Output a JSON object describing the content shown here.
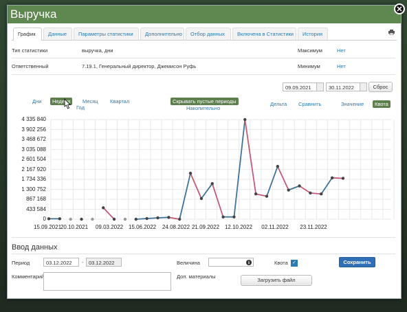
{
  "window": {
    "title": "Выручка"
  },
  "tabs": [
    {
      "label": "График"
    },
    {
      "label": "Данные"
    },
    {
      "label": "Параметры статистики"
    },
    {
      "label": "Дополнительно"
    },
    {
      "label": "Отбор данных"
    },
    {
      "label": "Включена в Статистики"
    },
    {
      "label": "История"
    }
  ],
  "info": {
    "type_label": "Тип статистики",
    "type_value": "выручка, дни",
    "resp_label": "Ответственный",
    "resp_value": "7.19.1, Генеральный директор, Джемисон Руфь",
    "max_label": "Максимум",
    "max_value": "Нет",
    "min_label": "Минимум",
    "min_value": "Нет"
  },
  "range": {
    "from": "09.09.2021",
    "to": "30.11.2022",
    "reset_label": "Сброс"
  },
  "period": {
    "days": "Дни",
    "week": "Неделя",
    "month": "Месяц",
    "quarter": "Квартал",
    "year": "Год",
    "hide_empty": "Скрывать пустые периоды",
    "cumulative": "Накопительно",
    "delta": "Дельта",
    "compare": "Сравнить",
    "value": "Значение",
    "quota": "Квота"
  },
  "chart_data": {
    "type": "line",
    "y_ticks": [
      "4 335 840",
      "3 902 256",
      "3 468 672",
      "3 035 088",
      "2 601 504",
      "2 167 920",
      "1 734 336",
      "1 300 752",
      "867 168",
      "433 584",
      "0"
    ],
    "ylim": [
      0,
      4335840
    ],
    "x_ticks": [
      "15.09.2021",
      "20.10.2021",
      "09.03.2022",
      "15.06.2022",
      "24.08.2022",
      "21.09.2022",
      "12.10.2022",
      "02.11.2022",
      "23.11.2022"
    ],
    "colors": {
      "rise": "#3f7398",
      "fall": "#c45a77",
      "point": "#444444",
      "empty_point": "#999999"
    },
    "series": [
      {
        "values": [
          20000,
          20000,
          null,
          0,
          null,
          500000,
          0,
          null,
          0,
          30000,
          60000,
          80000,
          0,
          2000000,
          900000,
          1550000,
          100000,
          100000,
          4335840,
          1100000,
          1000000,
          2300000,
          1270000,
          1450000,
          1140000,
          1100000,
          1800000,
          1780000
        ],
        "empty_indices": [
          2,
          4,
          7
        ]
      }
    ]
  },
  "data_entry": {
    "title": "Ввод данных",
    "period_label": "Период",
    "period_from": "03.12.2022",
    "period_to": "03.12.2022",
    "value_label": "Величина",
    "quota_label": "Квота",
    "save_label": "Сохранить",
    "comment_label": "Комментарий",
    "materials_label": "Доп. материалы",
    "upload_label": "Загрузить файл"
  }
}
